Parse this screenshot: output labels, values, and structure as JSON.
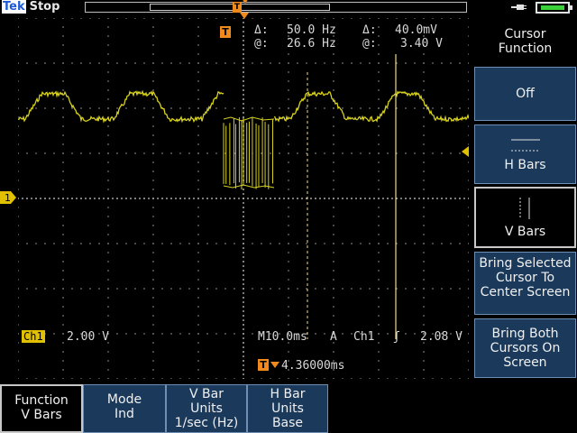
{
  "header": {
    "brand": "Tek",
    "run_state": "Stop",
    "trigger_marker": "T"
  },
  "readouts": {
    "cursor_badge": "T",
    "delta_sym": "Δ:",
    "at_sym": "@:",
    "v_delta": "50.0 Hz",
    "v_at": "26.6 Hz",
    "h_delta": "40.0mV",
    "h_at": "3.40 V",
    "ch1_label": "Ch1",
    "ch1_scale": "2.00 V",
    "timebase": "M10.0ms",
    "trigger_mode": "A",
    "trigger_source": "Ch1",
    "trigger_slope": "ʃ",
    "trigger_level": "2.08 V",
    "trigger_pos_badge": "T",
    "trigger_pos": "4.36000ms",
    "ch1_marker": "1"
  },
  "side_menu": {
    "title": "Cursor Function",
    "items": [
      {
        "label": "Off"
      },
      {
        "label": "H Bars"
      },
      {
        "label": "V Bars"
      },
      {
        "label": "Bring Selected Cursor To Center Screen"
      },
      {
        "label": "Bring Both Cursors On Screen"
      }
    ]
  },
  "bottom_menu": [
    {
      "line1": "Function",
      "line2": "V Bars"
    },
    {
      "line1": "Mode",
      "line2": "Ind"
    },
    {
      "line1": "V Bar",
      "line2": "Units",
      "line3": "1/sec (Hz)"
    },
    {
      "line1": "H Bar",
      "line2": "Units",
      "line3": "Base"
    }
  ],
  "colors": {
    "trace": "#d8d21e",
    "trigger": "#f08a1c",
    "menu_bg": "#1b3a5b",
    "grid": "#bdbdbd"
  },
  "icons": [
    "plug-icon",
    "battery-icon"
  ]
}
